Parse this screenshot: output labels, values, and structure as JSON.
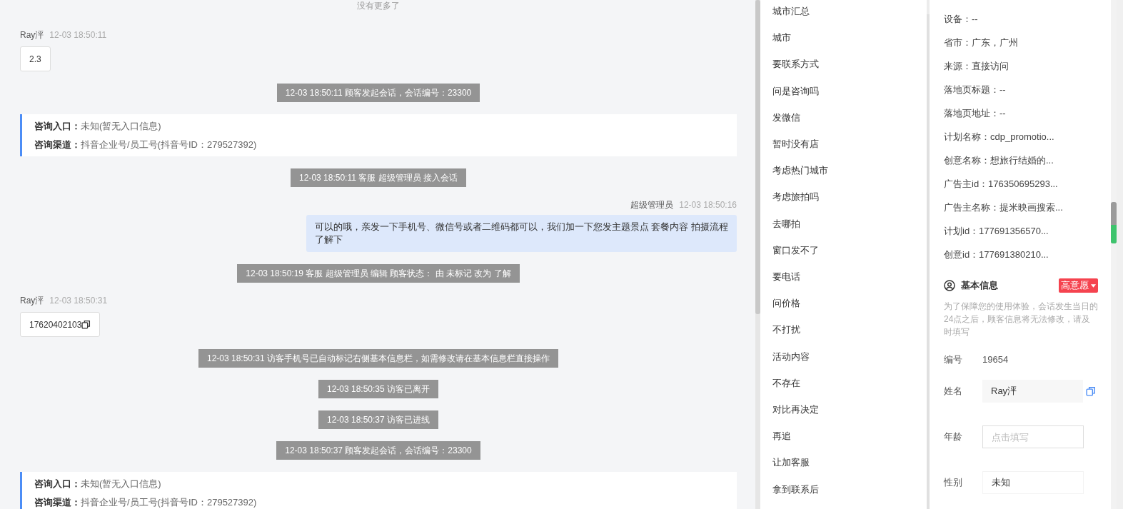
{
  "chat": {
    "top_notice": "没有更多了",
    "messages": [
      {
        "kind": "customer",
        "sender": "Ray泙",
        "time": "12-03 18:50:11",
        "text": "2.3",
        "copyable": false
      },
      {
        "kind": "system",
        "text": "12-03 18:50:11 顾客发起会话，会话编号：23300"
      },
      {
        "kind": "info",
        "rows": [
          {
            "label": "咨询入口：",
            "value": "未知(暂无入口信息)"
          },
          {
            "label": "咨询渠道：",
            "value": "抖音企业号/员工号(抖音号ID：279527392)"
          }
        ]
      },
      {
        "kind": "system",
        "text": "12-03 18:50:11 客服 超级管理员 接入会话"
      },
      {
        "kind": "agent",
        "sender": "超级管理员",
        "time": "12-03 18:50:16",
        "text": "可以的哦，亲发一下手机号、微信号或者二维码都可以，我们加一下您发主题景点 套餐内容 拍摄流程了解下"
      },
      {
        "kind": "system",
        "text": "12-03 18:50:19 客服 超级管理员 编辑 顾客状态： 由 未标记 改为 了解"
      },
      {
        "kind": "customer",
        "sender": "Ray泙",
        "time": "12-03 18:50:31",
        "text": "17620402103",
        "copyable": true
      },
      {
        "kind": "system",
        "text": "12-03 18:50:31 访客手机号已自动标记右侧基本信息栏，如需修改请在基本信息栏直接操作"
      },
      {
        "kind": "system",
        "text": "12-03 18:50:35 访客已离开"
      },
      {
        "kind": "system",
        "text": "12-03 18:50:37 访客已进线"
      },
      {
        "kind": "system",
        "text": "12-03 18:50:37 顾客发起会话，会话编号：23300"
      },
      {
        "kind": "info",
        "rows": [
          {
            "label": "咨询入口：",
            "value": "未知(暂无入口信息)"
          },
          {
            "label": "咨询渠道：",
            "value": "抖音企业号/员工号(抖音号ID：279527392)"
          }
        ]
      }
    ]
  },
  "quick_replies": [
    "城市汇总",
    "城市",
    "要联系方式",
    "问是咨询吗",
    "发微信",
    "暂时没有店",
    "考虑热门城市",
    "考虑旅拍吗",
    "去哪拍",
    "窗口发不了",
    "要电话",
    "问价格",
    "不打扰",
    "活动内容",
    "不存在",
    "对比再决定",
    "再追",
    "让加客服",
    "拿到联系后"
  ],
  "source_info": [
    "设备：--",
    "省市：广东，广州",
    "来源：直接访问",
    "落地页标题：--",
    "落地页地址：--",
    "计划名称：cdp_promotio...",
    "创意名称：想旅行结婚的...",
    "广告主id：176350695293...",
    "广告主名称：提米映画搜索...",
    "计划id：177691356570...",
    "创意id：177691380210..."
  ],
  "basic_info": {
    "title": "基本信息",
    "intent_tag": "高意愿",
    "notice": "为了保障您的使用体验，会话发生当日的24点之后，顾客信息将无法修改，请及时填写",
    "fields": [
      {
        "kind": "text",
        "label": "编号",
        "value": "19654"
      },
      {
        "kind": "filled",
        "label": "姓名",
        "value": "Ray泙"
      },
      {
        "kind": "input",
        "label": "年龄",
        "placeholder": "点击填写"
      },
      {
        "kind": "select",
        "label": "性别",
        "value": "未知"
      }
    ]
  }
}
